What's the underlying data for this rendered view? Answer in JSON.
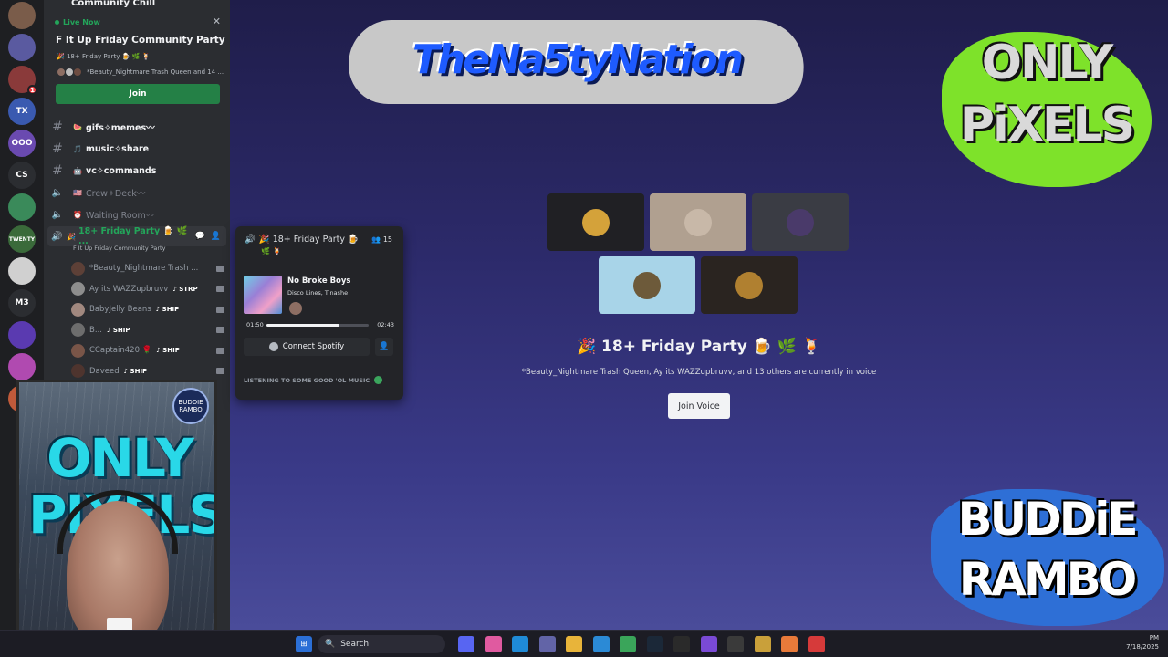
{
  "guild": {
    "name": "Community Chill"
  },
  "live": {
    "tag": "Live Now",
    "title": "F It Up Friday Community Party",
    "subtitle": "🎉 18+ Friday Party 🍺 🌿 🍹",
    "users": "*Beauty_Nightmare Trash Queen and 14 ...",
    "join_label": "Join",
    "close": "✕"
  },
  "channels": [
    {
      "name": "gifs✧memes〰",
      "emoji": "🍉"
    },
    {
      "name": "music✧share",
      "emoji": "🎵"
    },
    {
      "name": "vc✧commands",
      "emoji": "🤖"
    }
  ],
  "voice_channels": [
    {
      "name": "Crew✧Deck〰",
      "emoji": "🇺🇸"
    },
    {
      "name": "Waiting Room〰",
      "emoji": "⏰"
    }
  ],
  "active_voice": {
    "name": "18+ Friday Party 🍺 🌿 ...",
    "event": "F It Up Friday Community Party"
  },
  "voice_users": [
    {
      "name": "*Beauty_Nightmare Trash ...",
      "tag": "",
      "color": "#5d4037"
    },
    {
      "name": "Ay its WAZZupbruvv",
      "tag": "♪ STRP",
      "color": "#8d8d8d"
    },
    {
      "name": "BabyJelly Beans",
      "tag": "♪ SHIP",
      "color": "#a1887f"
    },
    {
      "name": "B...",
      "tag": "♪ SHIP",
      "color": "#6d6d6d"
    },
    {
      "name": "CCaptain420 🌹",
      "tag": "♪ SHIP",
      "color": "#795548"
    },
    {
      "name": "Daveed",
      "tag": "♪ SHIP",
      "color": "#4e342e"
    }
  ],
  "popup": {
    "title": "🎉 18+ Friday Party 🍺",
    "title_line2": "🌿 🍹",
    "count": "👥 15",
    "song": "No Broke Boys",
    "artist": "Disco Lines, Tinashe",
    "elapsed": "01:50",
    "duration": "02:43",
    "progress": 0.71,
    "spotify_label": "Connect Spotify",
    "status": "LISTENING TO SOME GOOD 'OL MUSIC"
  },
  "webcam": {
    "overlay_text": "ONLY PIXELS",
    "badge": "BUDDIE RAMBO"
  },
  "stage": {
    "title": "🎉 18+ Friday Party 🍺 🌿 🍹",
    "subtitle": "*Beauty_Nightmare Trash Queen, Ay its WAZZupbruvv, and 13 others are currently in voice",
    "join_voice_label": "Join Voice",
    "tiles": [
      {
        "bg": "#202024",
        "avatar": "#d4a23a"
      },
      {
        "bg": "#b0a090",
        "avatar": "#c8b8a8"
      },
      {
        "bg": "#3a3c44",
        "avatar": "#4a3a6a"
      },
      {
        "bg": "#a8d4e8",
        "avatar": "#6d5a3a"
      },
      {
        "bg": "#2a2420",
        "avatar": "#b08030"
      }
    ]
  },
  "logos": {
    "nasty": "TheNa5tyNation",
    "pixels_line1": "ONLY",
    "pixels_line2": "PiXELS",
    "buddie_line1": "BUDDiE",
    "buddie_line2": "RAMBO"
  },
  "rail": [
    {
      "label": "",
      "color": "#7a5c4a"
    },
    {
      "label": "",
      "color": "#5a5aa0"
    },
    {
      "label": "",
      "color": "#8a3a3a",
      "ping": "1"
    },
    {
      "label": "TX",
      "color": "#3a5ab0"
    },
    {
      "label": "OOO",
      "color": "#6a4ab0"
    },
    {
      "label": "CS",
      "color": "#2b2d31"
    },
    {
      "label": "",
      "color": "#3a8a5a"
    },
    {
      "label": "TWENTY",
      "color": "#3a6a3a"
    },
    {
      "label": "",
      "color": "#d0d0d0"
    },
    {
      "label": "M3",
      "color": "#2b2d31"
    },
    {
      "label": "",
      "color": "#5a3ab0"
    },
    {
      "label": "",
      "color": "#b04ab0"
    },
    {
      "label": "",
      "color": "#c05a3a"
    }
  ],
  "taskbar": {
    "search_placeholder": "Search",
    "time": "PM",
    "date": "7/18/2025",
    "apps": [
      {
        "name": "discord",
        "color": "#5865f2"
      },
      {
        "name": "copilot",
        "color": "#e05aa0"
      },
      {
        "name": "edge",
        "color": "#1f8ad6"
      },
      {
        "name": "teams",
        "color": "#6264a7"
      },
      {
        "name": "files",
        "color": "#e8b43a"
      },
      {
        "name": "store",
        "color": "#2b8ad6"
      },
      {
        "name": "chrome",
        "color": "#3aa55a"
      },
      {
        "name": "steam",
        "color": "#1b2838"
      },
      {
        "name": "obs",
        "color": "#2a2a2a"
      },
      {
        "name": "app1",
        "color": "#7a4ad6"
      },
      {
        "name": "app2",
        "color": "#3a3a3a"
      },
      {
        "name": "app3",
        "color": "#c9a03a"
      },
      {
        "name": "app4",
        "color": "#e87a3a"
      },
      {
        "name": "app5",
        "color": "#d63a3a"
      }
    ]
  }
}
